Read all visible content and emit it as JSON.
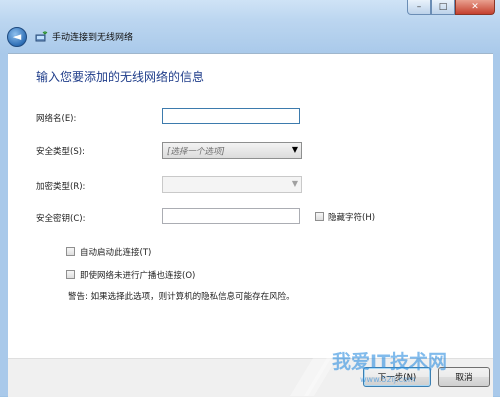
{
  "window": {
    "title": "手动连接到无线网络",
    "caption_buttons": {
      "minimize": "–",
      "maximize": "□",
      "close": "✕"
    },
    "back_icon": "back-arrow-icon",
    "wizard_icon": "wireless-network-icon"
  },
  "form": {
    "heading": "输入您要添加的无线网络的信息",
    "network_name": {
      "label": "网络名(E):",
      "value": ""
    },
    "security_type": {
      "label": "安全类型(S):",
      "selected": "[选择一个选项]"
    },
    "encryption_type": {
      "label": "加密类型(R):",
      "selected": ""
    },
    "security_key": {
      "label": "安全密钥(C):",
      "value": "",
      "hide_chars_label": "隐藏字符(H)",
      "hide_chars_checked": false
    },
    "auto_start": {
      "label": "自动启动此连接(T)",
      "checked": false
    },
    "connect_hidden": {
      "label": "即使网络未进行广播也连接(O)",
      "checked": false
    },
    "warning": "警告: 如果选择此选项，则计算机的隐私信息可能存在风险。"
  },
  "footer": {
    "next_label": "下一步(N)",
    "cancel_label": "取消"
  },
  "watermark": {
    "text": "我爱IT技术网",
    "url": "www.52ij.com"
  },
  "colors": {
    "heading": "#1f3d8a",
    "frame": "#a9c9ea",
    "close_button": "#c4402e"
  }
}
